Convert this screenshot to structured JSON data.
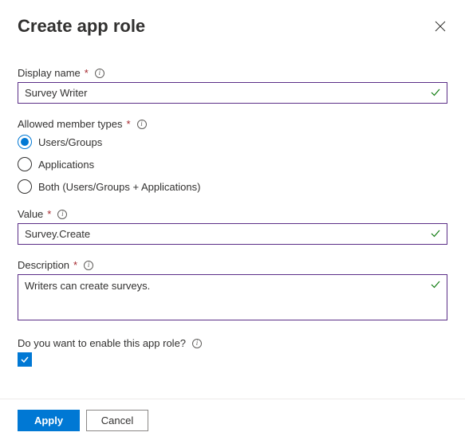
{
  "header": {
    "title": "Create app role"
  },
  "fields": {
    "displayName": {
      "label": "Display name",
      "value": "Survey Writer"
    },
    "memberTypes": {
      "label": "Allowed member types",
      "options": {
        "usersGroups": "Users/Groups",
        "applications": "Applications",
        "both": "Both (Users/Groups + Applications)"
      },
      "selected": "usersGroups"
    },
    "value": {
      "label": "Value",
      "value": "Survey.Create"
    },
    "description": {
      "label": "Description",
      "value": "Writers can create surveys."
    },
    "enable": {
      "label": "Do you want to enable this app role?",
      "checked": true
    }
  },
  "footer": {
    "apply": "Apply",
    "cancel": "Cancel"
  }
}
